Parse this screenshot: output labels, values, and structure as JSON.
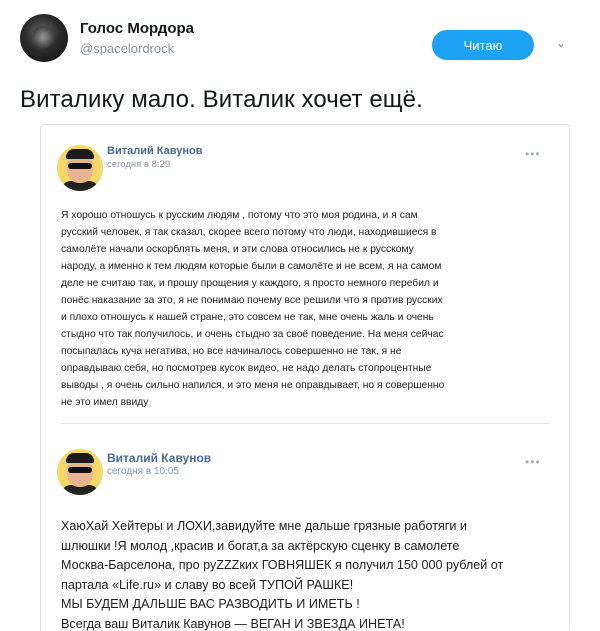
{
  "tweet": {
    "display_name": "Голос Мордора",
    "handle": "@spacelordrock",
    "follow_label": "Читаю",
    "text": "Виталику мало. Виталик хочет ещё."
  },
  "posts": [
    {
      "author": "Виталий Кавунов",
      "time": "сегодня в 8:29",
      "more": "•••",
      "lines": [
        "Я хорошо отношусь к русским людям , потому что это моя родина, и я сам",
        "русский человек, я так сказал, скорее всего потому что люди, находившиеся в",
        "самолёте начали оскорблять меня, и эти слова относились не к русскому",
        "народу, а именно к тем людям которые были в самолёте и не всем, я на самом",
        "деле не считаю так, и прошу прощения у каждого, я просто немного перебил и",
        "понёс наказание за это, я не понимаю почему все решили что я против русских",
        "и плохо отношусь к нашей стране, это совсем не так, мне очень жаль и очень",
        "стыдно что так получилось, и очень стыдно за своё поведение. На меня сейчас",
        "посыпалась куча негатива, но все начиналось совершенно не так, я не",
        "оправдываю себя, но посмотрев кусок видео, не надо делать стопроцентные",
        "выводы , я очень сильно напился, и это меня не оправдывает, но я совершенно",
        "не это имел ввиду"
      ]
    },
    {
      "author": "Виталий Кавунов",
      "time": "сегодня в 10:05",
      "more": "•••",
      "lines": [
        "ХаюХай Хейтеры и ЛОХИ,завидуйте мне дальше грязные работяги и",
        "шлюшки !Я молод ,красив и богат,а за актёрскую сценку в самолете",
        "Москва-Барселона, про руZZZких ГОВНЯШЕК я получил 150 000 рублей от",
        "партала «Life.ru» и славу во всей ТУПОЙ РАШКЕ!",
        "МЫ БУДЕМ ДАЛЬШЕ ВАС РАЗВОДИТЬ И ИМЕТЬ !",
        "Всегда ваш Виталик Кавунов — ВЕГАН И ЗВЕЗДА ИНЕТА!"
      ]
    }
  ],
  "colors": {
    "accent": "#1da1f2",
    "vk_name": "#4a6a92"
  },
  "icons": {
    "follow_menu": "chevron-down-icon"
  }
}
